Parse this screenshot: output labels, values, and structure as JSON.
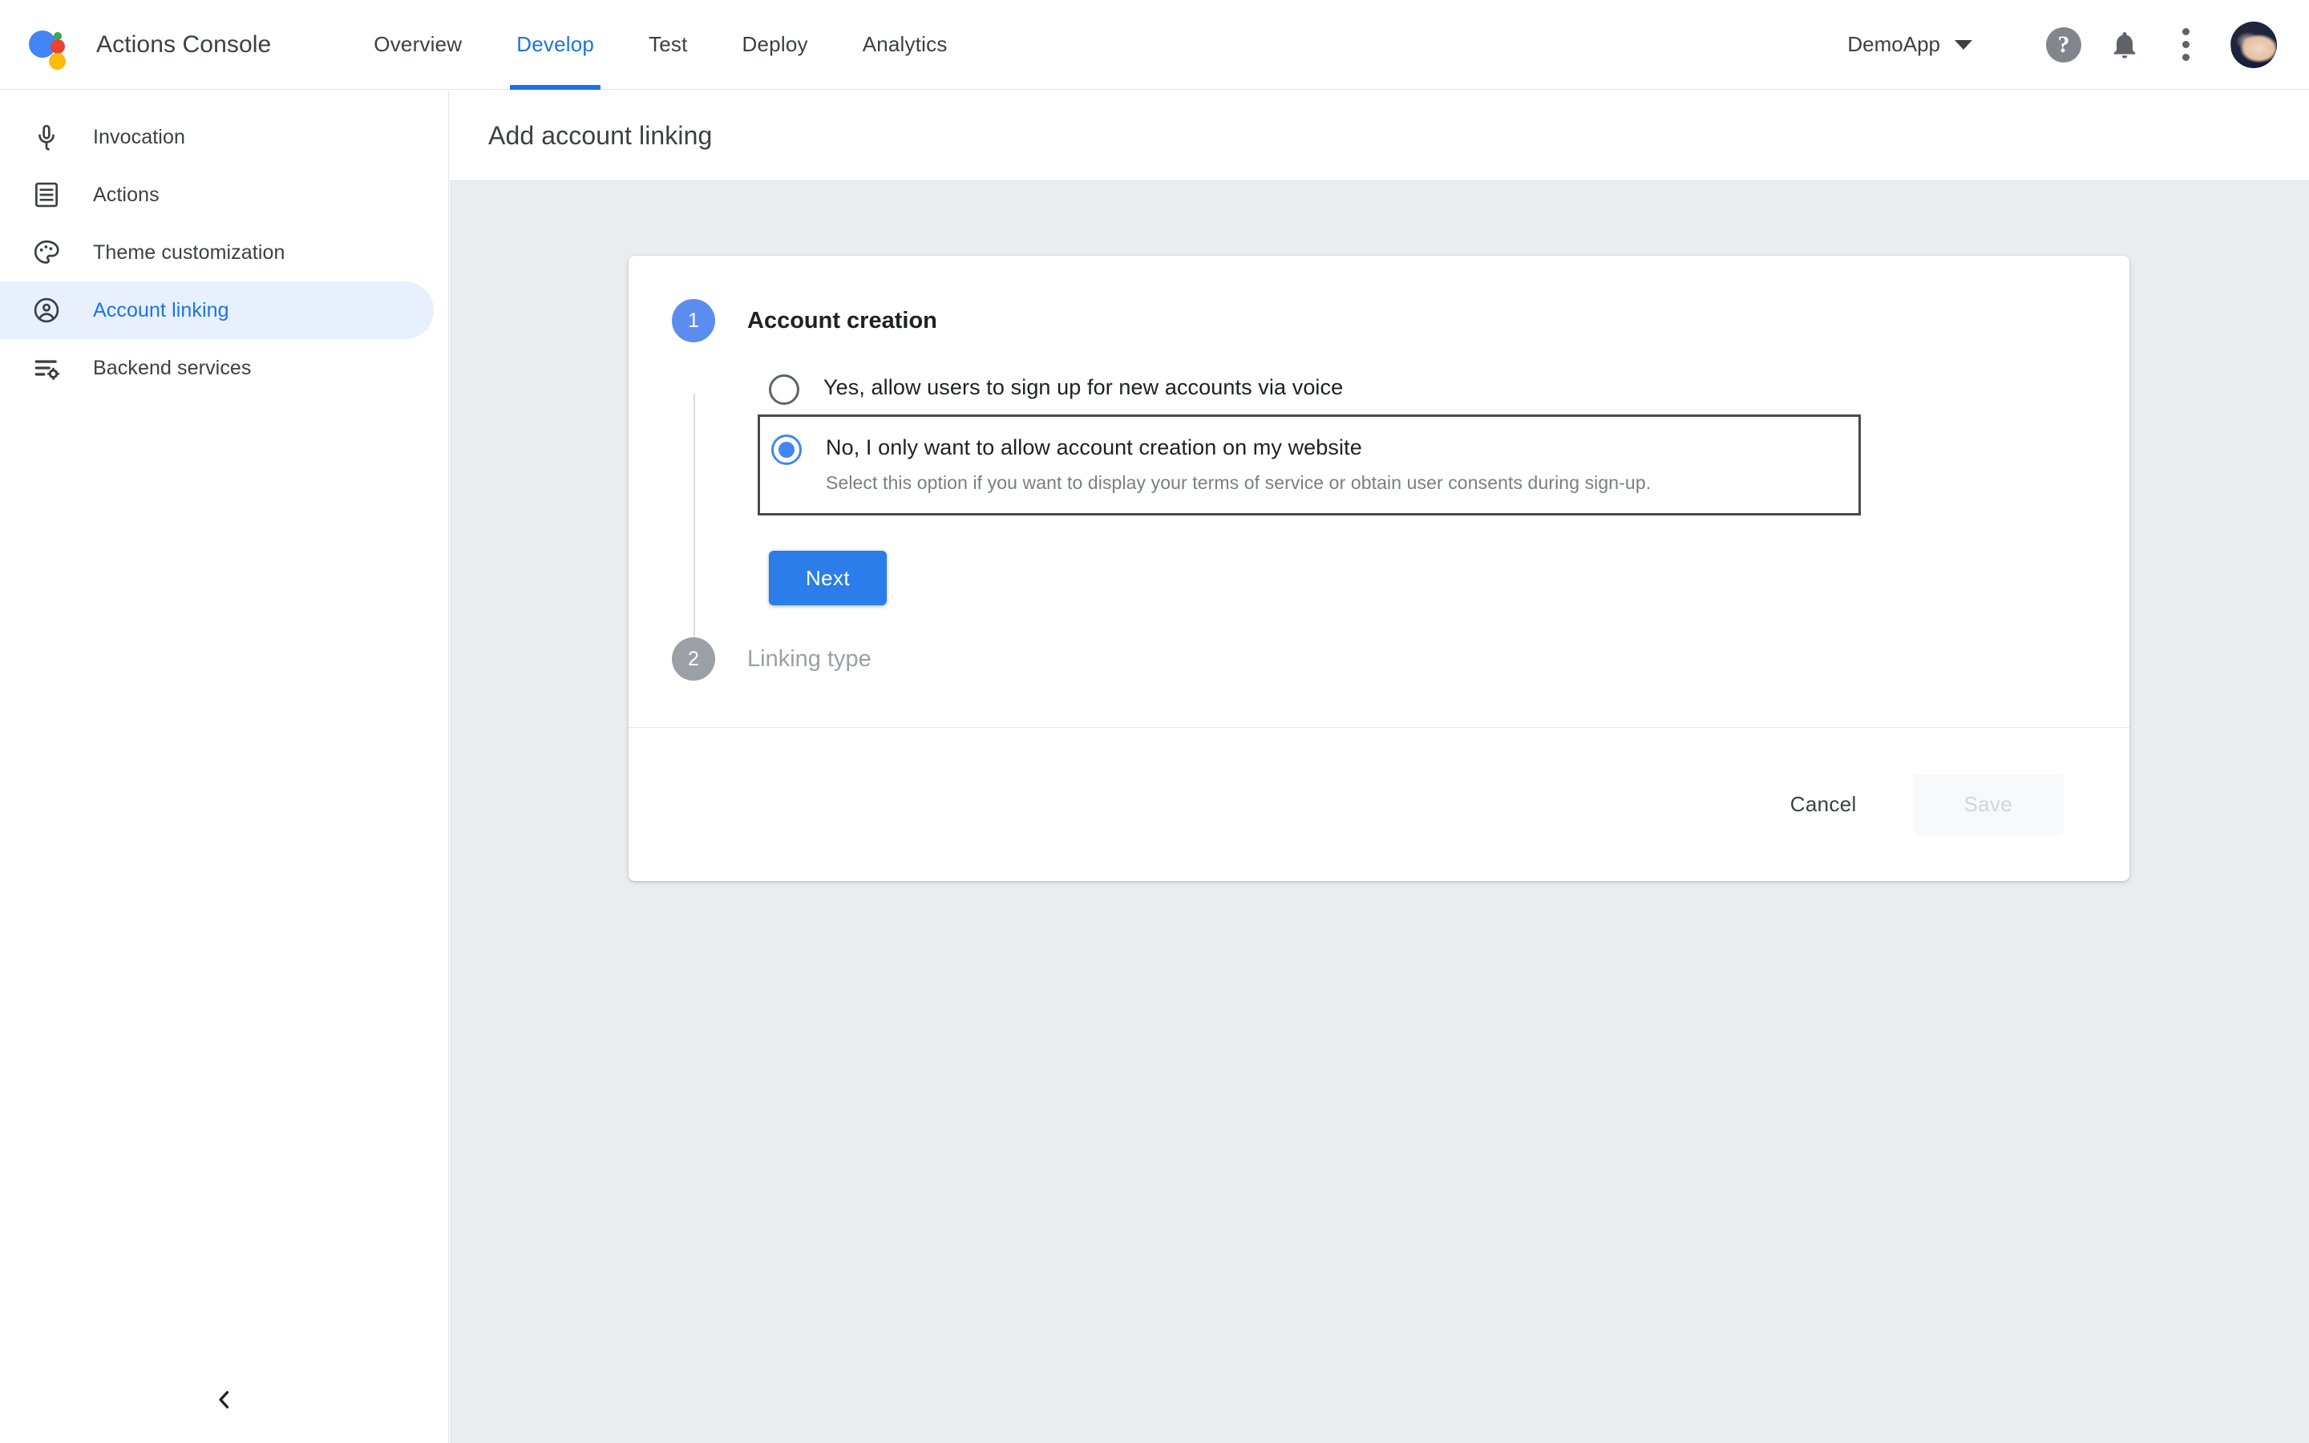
{
  "topbar": {
    "logo_icon": "google-assistant-logo",
    "brand_title": "Actions Console",
    "tabs": [
      {
        "label": "Overview",
        "active": false
      },
      {
        "label": "Develop",
        "active": true
      },
      {
        "label": "Test",
        "active": false
      },
      {
        "label": "Deploy",
        "active": false
      },
      {
        "label": "Analytics",
        "active": false
      }
    ],
    "project_select": {
      "label": "DemoApp",
      "icon": "chevron-down-icon"
    },
    "help_icon": "help-circle-icon",
    "notifications_icon": "bell-icon",
    "more_icon": "kebab-menu-icon",
    "avatar_icon": "user-avatar"
  },
  "sidebar": {
    "items": [
      {
        "label": "Invocation",
        "icon": "microphone-icon",
        "active": false
      },
      {
        "label": "Actions",
        "icon": "document-list-icon",
        "active": false
      },
      {
        "label": "Theme customization",
        "icon": "palette-icon",
        "active": false
      },
      {
        "label": "Account linking",
        "icon": "account-circle-icon",
        "active": true
      },
      {
        "label": "Backend services",
        "icon": "list-settings-icon",
        "active": false
      }
    ],
    "collapse_icon": "chevron-left-icon"
  },
  "page": {
    "title": "Add account linking"
  },
  "card": {
    "steps": [
      {
        "number": "1",
        "title": "Account creation",
        "state": "active"
      },
      {
        "number": "2",
        "title": "Linking type",
        "state": "inactive"
      }
    ],
    "options": [
      {
        "label": "Yes, allow users to sign up for new accounts via voice",
        "help": "",
        "selected": false
      },
      {
        "label": "No, I only want to allow account creation on my website",
        "help": "Select this option if you want to display your terms of service or obtain user consents during sign-up.",
        "selected": true
      }
    ],
    "next_label": "Next",
    "cancel_label": "Cancel",
    "save_label": "Save"
  },
  "colors": {
    "accent_blue": "#1a73e8",
    "button_blue": "#2b7de9",
    "step_active": "#5b8def",
    "step_inactive": "#9aa0a6",
    "page_bg": "#eaedf0",
    "sidebar_active_bg": "#e8f0fe"
  }
}
